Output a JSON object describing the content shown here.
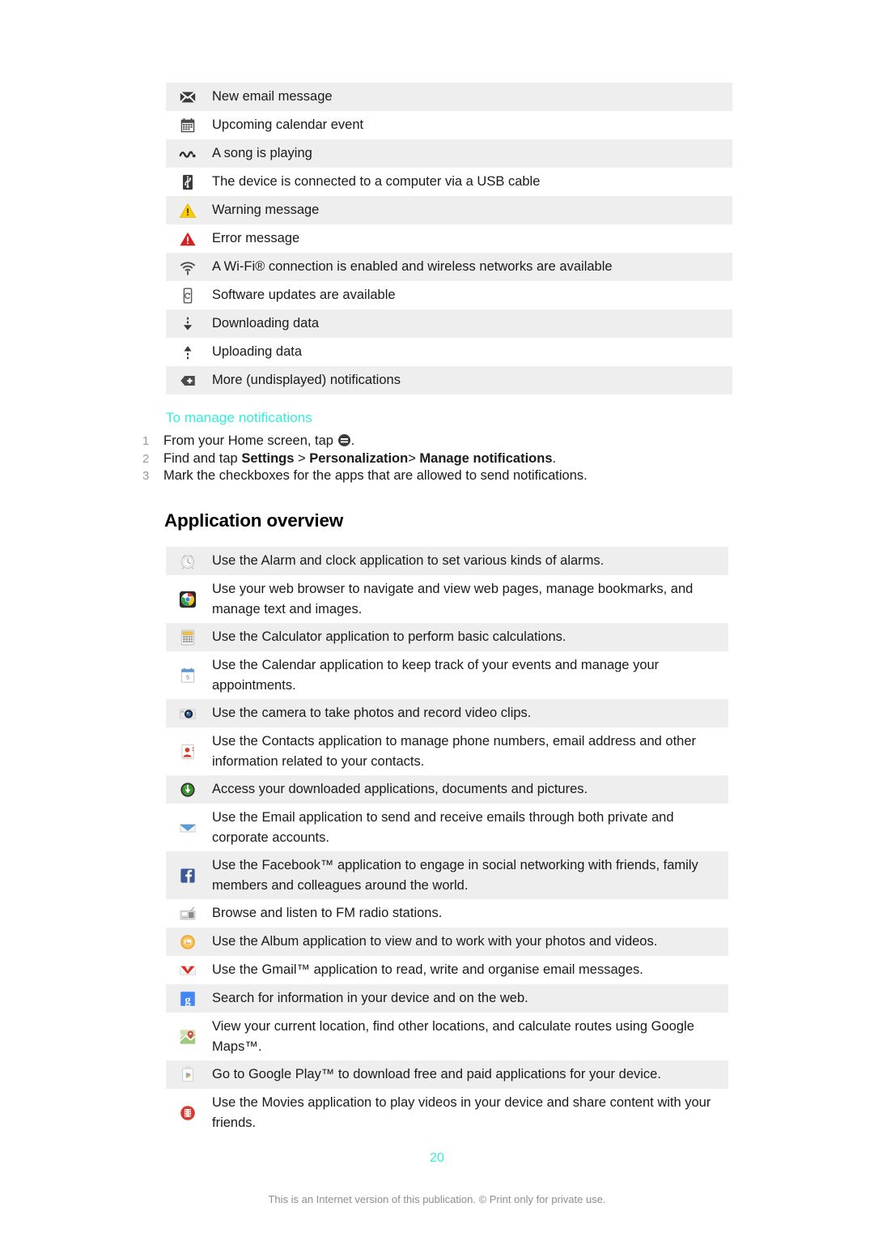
{
  "notification_icons": [
    {
      "icon": "envelope-icon",
      "text": "New email message"
    },
    {
      "icon": "calendar-icon",
      "text": "Upcoming calendar event"
    },
    {
      "icon": "music-note-icon",
      "text": "A song is playing"
    },
    {
      "icon": "usb-icon",
      "text": "The device is connected to a computer via a USB cable"
    },
    {
      "icon": "warning-triangle-icon",
      "text": "Warning message"
    },
    {
      "icon": "error-triangle-icon",
      "text": "Error message"
    },
    {
      "icon": "wifi-icon",
      "text": "A Wi-Fi® connection is enabled and wireless networks are available"
    },
    {
      "icon": "software-update-icon",
      "text": "Software updates are available"
    },
    {
      "icon": "download-arrow-icon",
      "text": "Downloading data"
    },
    {
      "icon": "upload-arrow-icon",
      "text": "Uploading data"
    },
    {
      "icon": "more-notifications-icon",
      "text": "More (undisplayed) notifications"
    }
  ],
  "manage_notifications": {
    "heading": "To manage notifications",
    "steps": [
      {
        "num": "1",
        "before": "From your Home screen, tap ",
        "bold": "",
        "after": "."
      },
      {
        "num": "2",
        "before": "Find and tap ",
        "bold": "Settings",
        "mid": " > ",
        "bold2": "Personalization",
        "mid2": "> ",
        "bold3": "Manage notifications",
        "after": "."
      },
      {
        "num": "3",
        "before": "Mark the checkboxes for the apps that are allowed to send notifications.",
        "bold": "",
        "after": ""
      }
    ]
  },
  "application_overview": {
    "heading": "Application overview",
    "apps": [
      {
        "icon": "alarm-clock-icon",
        "text": "Use the Alarm and clock application to set various kinds of alarms."
      },
      {
        "icon": "browser-chrome-icon",
        "text": "Use your web browser to navigate and view web pages, manage bookmarks, and manage text and images."
      },
      {
        "icon": "calculator-icon",
        "text": "Use the Calculator application to perform basic calculations."
      },
      {
        "icon": "calendar-app-icon",
        "text": "Use the Calendar application to keep track of your events and manage your appointments."
      },
      {
        "icon": "camera-icon",
        "text": "Use the camera to take photos and record video clips."
      },
      {
        "icon": "contacts-icon",
        "text": "Use the Contacts application to manage phone numbers, email address and other information related to your contacts."
      },
      {
        "icon": "downloads-icon",
        "text": "Access your downloaded applications, documents and pictures."
      },
      {
        "icon": "email-icon",
        "text": "Use the Email application to send and receive emails through both private and corporate accounts."
      },
      {
        "icon": "facebook-icon",
        "text": "Use the Facebook™ application to engage in social networking with friends, family members and colleagues around the world."
      },
      {
        "icon": "fm-radio-icon",
        "text": "Browse and listen to FM radio stations."
      },
      {
        "icon": "album-icon",
        "text": "Use the Album application to view and to work with your photos and videos."
      },
      {
        "icon": "gmail-icon",
        "text": "Use the Gmail™ application to read, write and organise email messages."
      },
      {
        "icon": "google-search-icon",
        "text": "Search for information in your device and on the web."
      },
      {
        "icon": "google-maps-icon",
        "text": "View your current location, find other locations, and calculate routes using Google Maps™."
      },
      {
        "icon": "google-play-icon",
        "text": "Go to Google Play™ to download free and paid applications for your device."
      },
      {
        "icon": "movies-icon",
        "text": "Use the Movies application to play videos in your device and share content with your friends."
      }
    ]
  },
  "footer": {
    "page_number": "20",
    "note": "This is an Internet version of this publication. © Print only for private use."
  },
  "colors": {
    "teal_accent": "#2ff0db",
    "stripe": "#eeeeee",
    "body_text": "#1a1a1a",
    "muted": "#8e8e8e"
  }
}
